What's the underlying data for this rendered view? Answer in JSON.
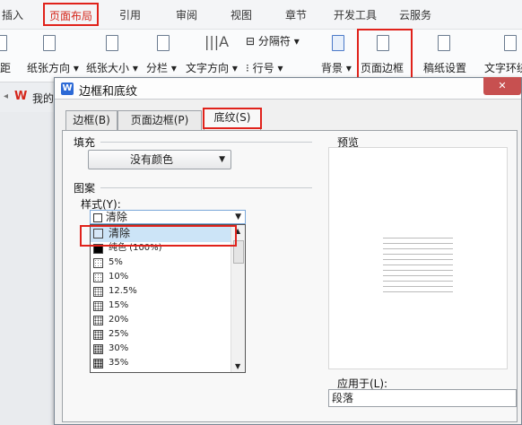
{
  "ribbon_tabs": [
    "插入",
    "页面布局",
    "引用",
    "审阅",
    "视图",
    "章节",
    "开发工具",
    "云服务"
  ],
  "active_tab": "页面布局",
  "ribbon": {
    "margin_partial": "距",
    "orientation": "纸张方向",
    "size": "纸张大小",
    "columns": "分栏",
    "text_direction": "文字方向",
    "separator": "分隔符",
    "line_number": "行号",
    "background": "背景",
    "page_border": "页面边框",
    "paper_setting": "稿纸设置",
    "text_wrap": "文字环绕"
  },
  "doc_tab_partial": "我的",
  "dialog": {
    "title": "边框和底纹",
    "close": "✕",
    "tabs": [
      "边框(B)",
      "页面边框(P)",
      "底纹(S)"
    ],
    "active_tab": "底纹(S)",
    "fill_label": "填充",
    "fill_value": "没有颜色",
    "pattern_label": "图案",
    "style_label": "样式(Y):",
    "style_value": "清除",
    "preview_label": "预览",
    "apply_label": "应用于(L):",
    "apply_value": "段落",
    "pattern_options": [
      "清除",
      "纯色 (100%)",
      "5%",
      "10%",
      "12.5%",
      "15%",
      "20%",
      "25%",
      "30%",
      "35%"
    ]
  },
  "colors": {
    "highlight": "#e0221b",
    "accent": "#d5261b"
  }
}
